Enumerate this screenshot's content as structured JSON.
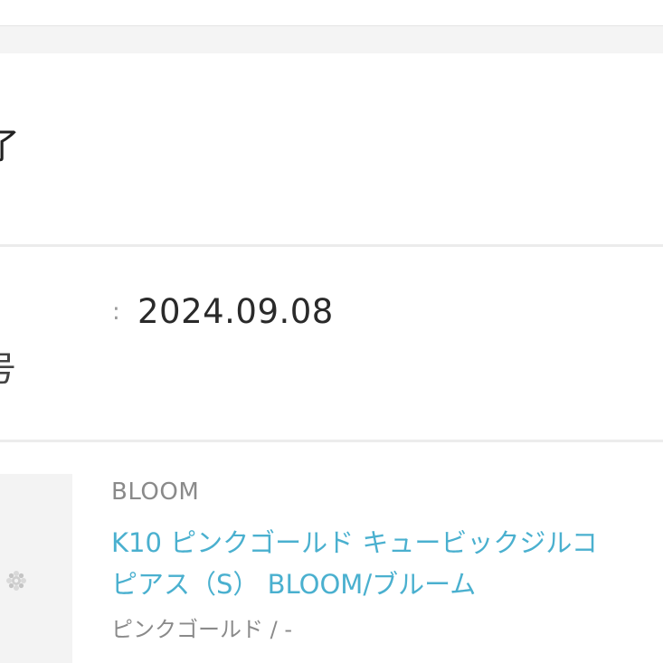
{
  "order_status": {
    "text": "了"
  },
  "order_info": {
    "separator": ":",
    "date": "2024.09.08",
    "label_fragment": "号"
  },
  "product": {
    "brand": "BLOOM",
    "name_line1": "K10 ピンクゴールド キュービックジルコ",
    "name_line2": "ピアス（S） BLOOM/ブルーム",
    "variant": "ピンクゴールド / -",
    "link_color": "#4ab0cf",
    "thumbnail_icon": "sparkle-earring-icon"
  }
}
